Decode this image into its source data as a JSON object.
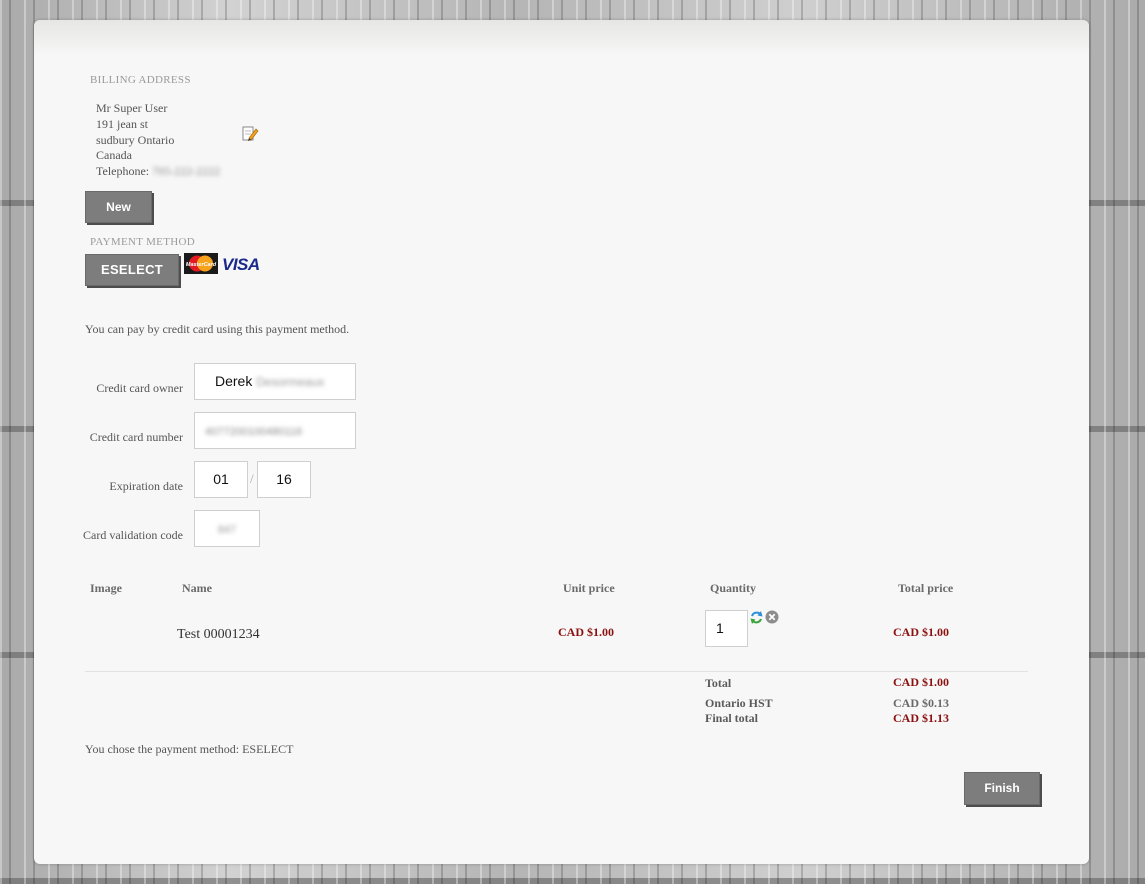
{
  "billing": {
    "title": "BILLING ADDRESS",
    "name": "Mr Super User",
    "street": "191 jean st",
    "city": "sudbury Ontario",
    "country": "Canada",
    "telephone_label": "Telephone:",
    "telephone_value": "705-222-2222",
    "edit_icon": "edit-pencil-icon",
    "new_button": "New"
  },
  "payment": {
    "title": "PAYMENT METHOD",
    "method_button": "ESELECT",
    "mastercard_text": "MasterCard",
    "visa_text": "VISA",
    "info_text": "You can pay by credit card using this payment method."
  },
  "form": {
    "owner_label": "Credit card owner",
    "owner_value": "Derek Desormeaux",
    "owner_first": "Derek",
    "owner_last": "Desormeaux",
    "number_label": "Credit card number",
    "number_value": "4077200100480116",
    "expiry_label": "Expiration date",
    "expiry_month": "01",
    "expiry_separator": "/",
    "expiry_year": "16",
    "cvc_label": "Card validation code",
    "cvc_value": "847"
  },
  "cart": {
    "headers": {
      "image": "Image",
      "name": "Name",
      "unit_price": "Unit price",
      "quantity": "Quantity",
      "total_price": "Total price"
    },
    "items": [
      {
        "name": "Test 00001234",
        "unit_price": "CAD $1.00",
        "quantity": "1",
        "total_price": "CAD $1.00"
      }
    ],
    "refresh_icon": "refresh-icon",
    "remove_icon": "remove-icon"
  },
  "summary": {
    "total_label": "Total",
    "total_value": "CAD $1.00",
    "tax_label": "Ontario HST",
    "tax_value": "CAD $0.13",
    "final_label": "Final total",
    "final_value": "CAD $1.13"
  },
  "chosen_text": "You chose the payment method: ESELECT",
  "finish_button": "Finish",
  "colors": {
    "accent_red": "#8b1010",
    "button_grey": "#7d7d7d",
    "panel": "#f7f7f7"
  }
}
